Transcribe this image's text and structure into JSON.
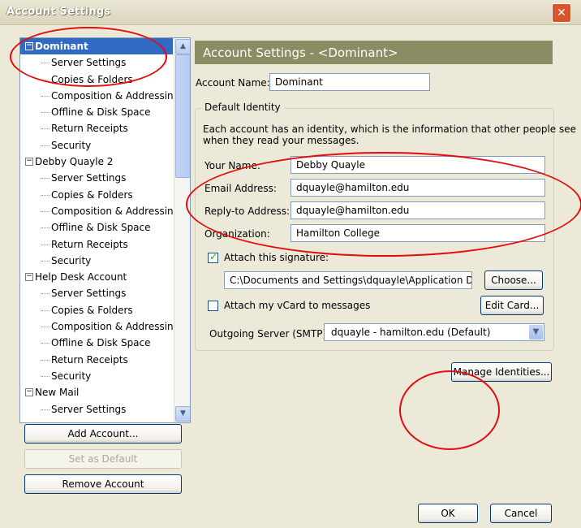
{
  "window": {
    "title": "Account Settings",
    "close_glyph": "✕"
  },
  "tree": {
    "accounts": [
      {
        "name": "Dominant",
        "items": [
          "Server Settings",
          "Copies & Folders",
          "Composition & Addressing",
          "Offline & Disk Space",
          "Return Receipts",
          "Security"
        ]
      },
      {
        "name": "Debby Quayle 2",
        "items": [
          "Server Settings",
          "Copies & Folders",
          "Composition & Addressing",
          "Offline & Disk Space",
          "Return Receipts",
          "Security"
        ]
      },
      {
        "name": "Help Desk Account",
        "items": [
          "Server Settings",
          "Copies & Folders",
          "Composition & Addressing",
          "Offline & Disk Space",
          "Return Receipts",
          "Security"
        ]
      },
      {
        "name": "New Mail",
        "items": [
          "Server Settings"
        ]
      }
    ],
    "expand_glyph": "−"
  },
  "buttons": {
    "add_account": "Add Account...",
    "set_default": "Set as Default",
    "remove_account": "Remove Account",
    "ok": "OK",
    "cancel": "Cancel",
    "choose": "Choose...",
    "edit_card": "Edit Card...",
    "manage_identities": "Manage Identities..."
  },
  "main": {
    "header": "Account Settings - <Dominant>",
    "account_name_label": "Account Name:",
    "account_name_value": "Dominant",
    "identity_group_title": "Default Identity",
    "identity_desc_1": "Each account has an identity, which is the information that other people see",
    "identity_desc_2": "when they read your messages.",
    "your_name_label": "Your Name:",
    "your_name_value": "Debby Quayle",
    "email_label": "Email Address:",
    "email_value": "dquayle@hamilton.edu",
    "reply_label": "Reply-to Address:",
    "reply_value": "dquayle@hamilton.edu",
    "org_label": "Organization:",
    "org_value": "Hamilton College",
    "attach_sig_label": "Attach this signature:",
    "attach_sig_checked": true,
    "sig_path": "C:\\Documents and Settings\\dquayle\\Application Data\\T",
    "vcard_label": "Attach my vCard to messages",
    "vcard_checked": false,
    "smtp_label": "Outgoing Server (SMTP):",
    "smtp_value": "dquayle - hamilton.edu (Default)"
  },
  "colors": {
    "annotation": "#E30B0B",
    "header_bg": "#8B8B64",
    "selection": "#316AC5"
  }
}
